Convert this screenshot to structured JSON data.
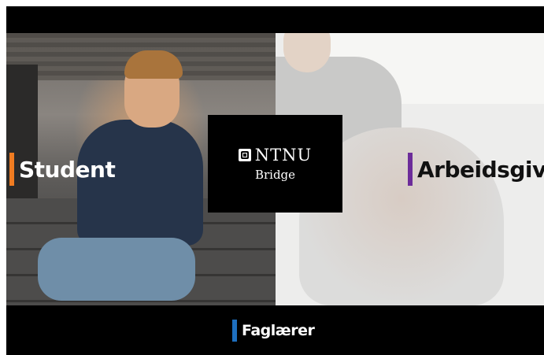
{
  "logo": {
    "name": "NTNU",
    "subtitle": "Bridge"
  },
  "panels": {
    "student": {
      "label": "Student",
      "accent": "#f07c21"
    },
    "arbeidsgiver": {
      "label": "Arbeidsgive",
      "accent": "#6c2c9a"
    },
    "faglaerer": {
      "label": "Faglærer",
      "accent": "#1e6fbf"
    }
  },
  "colors": {
    "background": "#000000",
    "arbeidsgiver_panel": "#ededec"
  }
}
